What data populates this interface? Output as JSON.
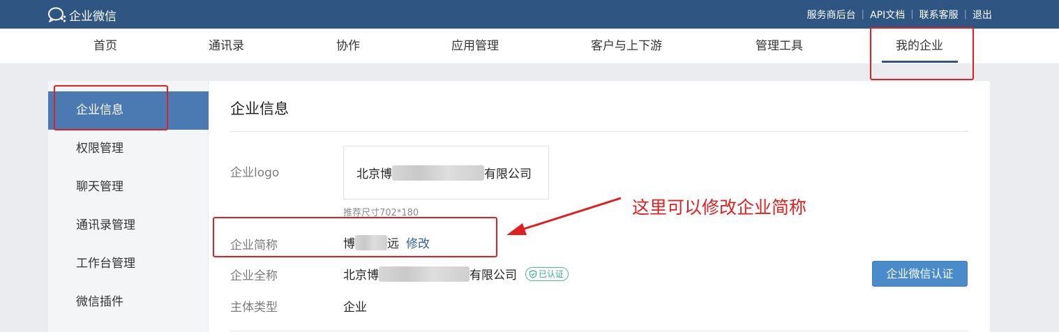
{
  "app": {
    "logo_text": "企业微信"
  },
  "top_links": [
    "服务商后台",
    "API文档",
    "联系客服",
    "退出"
  ],
  "nav": {
    "items": [
      "首页",
      "通讯录",
      "协作",
      "应用管理",
      "客户与上下游",
      "管理工具",
      "我的企业"
    ],
    "active": "我的企业"
  },
  "sidebar": {
    "items": [
      "企业信息",
      "权限管理",
      "聊天管理",
      "通讯录管理",
      "工作台管理",
      "微信插件"
    ],
    "active": "企业信息"
  },
  "main": {
    "title": "企业信息",
    "logo_label": "企业logo",
    "logo_text_prefix": "北京博",
    "logo_text_suffix": "有限公司",
    "logo_hint": "推荐尺寸702*180",
    "short_name_label": "企业简称",
    "short_name_prefix": "博",
    "short_name_suffix": "远",
    "edit_label": "修改",
    "full_name_label": "企业全称",
    "full_name_prefix": "北京博",
    "full_name_suffix": "有限公司",
    "verified_badge": "已认证",
    "type_label": "主体类型",
    "type_value": "企业",
    "cert_button": "企业微信认证"
  },
  "annotation": {
    "text": "这里可以修改企业简称"
  },
  "colors": {
    "topbar": "#2f5582",
    "accent": "#4b79b2",
    "highlight": "#e02020",
    "verified": "#33b07a"
  }
}
